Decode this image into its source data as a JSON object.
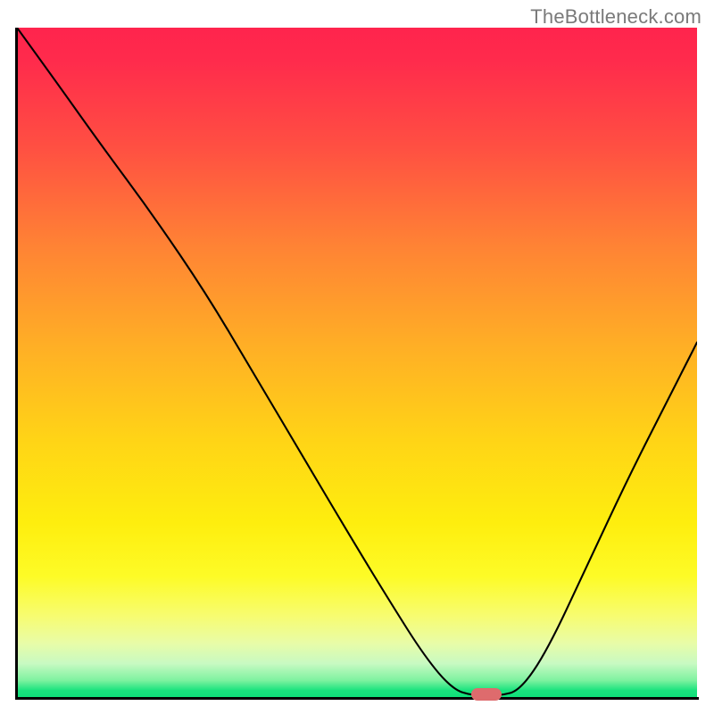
{
  "watermark": "TheBottleneck.com",
  "chart_data": {
    "type": "line",
    "title": "",
    "xlabel": "",
    "ylabel": "",
    "xlim": [
      0,
      100
    ],
    "ylim": [
      0,
      100
    ],
    "curve_points_pct": [
      {
        "x": 0.0,
        "y": 100.0
      },
      {
        "x": 5.0,
        "y": 93.0
      },
      {
        "x": 12.0,
        "y": 83.0
      },
      {
        "x": 20.0,
        "y": 72.0
      },
      {
        "x": 28.0,
        "y": 60.0
      },
      {
        "x": 35.0,
        "y": 48.0
      },
      {
        "x": 42.0,
        "y": 36.0
      },
      {
        "x": 49.0,
        "y": 24.0
      },
      {
        "x": 55.0,
        "y": 14.0
      },
      {
        "x": 60.0,
        "y": 6.0
      },
      {
        "x": 64.0,
        "y": 1.2
      },
      {
        "x": 67.0,
        "y": 0.2
      },
      {
        "x": 71.0,
        "y": 0.2
      },
      {
        "x": 74.0,
        "y": 1.0
      },
      {
        "x": 78.0,
        "y": 7.0
      },
      {
        "x": 84.0,
        "y": 20.0
      },
      {
        "x": 90.0,
        "y": 33.0
      },
      {
        "x": 96.0,
        "y": 45.0
      },
      {
        "x": 100.0,
        "y": 53.0
      }
    ],
    "optimal_marker": {
      "x_pct": 69.0,
      "y_pct": 0.4,
      "color": "#de6b6d"
    },
    "background_gradient": {
      "top": "#ff244d",
      "mid": "#ffd516",
      "bottom": "#0fdf7a"
    }
  }
}
